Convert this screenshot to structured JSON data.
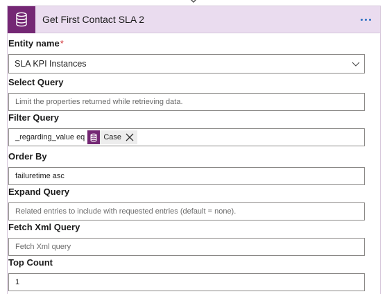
{
  "card": {
    "title": "Get First Contact SLA 2",
    "header_icon": "database-icon",
    "more_icon": "more-options-icon",
    "accent_color": "#742774",
    "header_bg": "#eadcef"
  },
  "fields": {
    "entity_name": {
      "label": "Entity name",
      "required_mark": "*",
      "value": "SLA KPI Instances"
    },
    "select_query": {
      "label": "Select Query",
      "placeholder": "Limit the properties returned while retrieving data."
    },
    "filter_query": {
      "label": "Filter Query",
      "value_text": "_regarding_value eq",
      "token": {
        "label": "Case",
        "icon": "database-icon"
      }
    },
    "order_by": {
      "label": "Order By",
      "value": "failuretime asc"
    },
    "expand_query": {
      "label": "Expand Query",
      "placeholder": "Related entries to include with requested entries (default = none)."
    },
    "fetch_xml_query": {
      "label": "Fetch Xml Query",
      "placeholder": "Fetch Xml query"
    },
    "top_count": {
      "label": "Top Count",
      "value": "1"
    }
  }
}
